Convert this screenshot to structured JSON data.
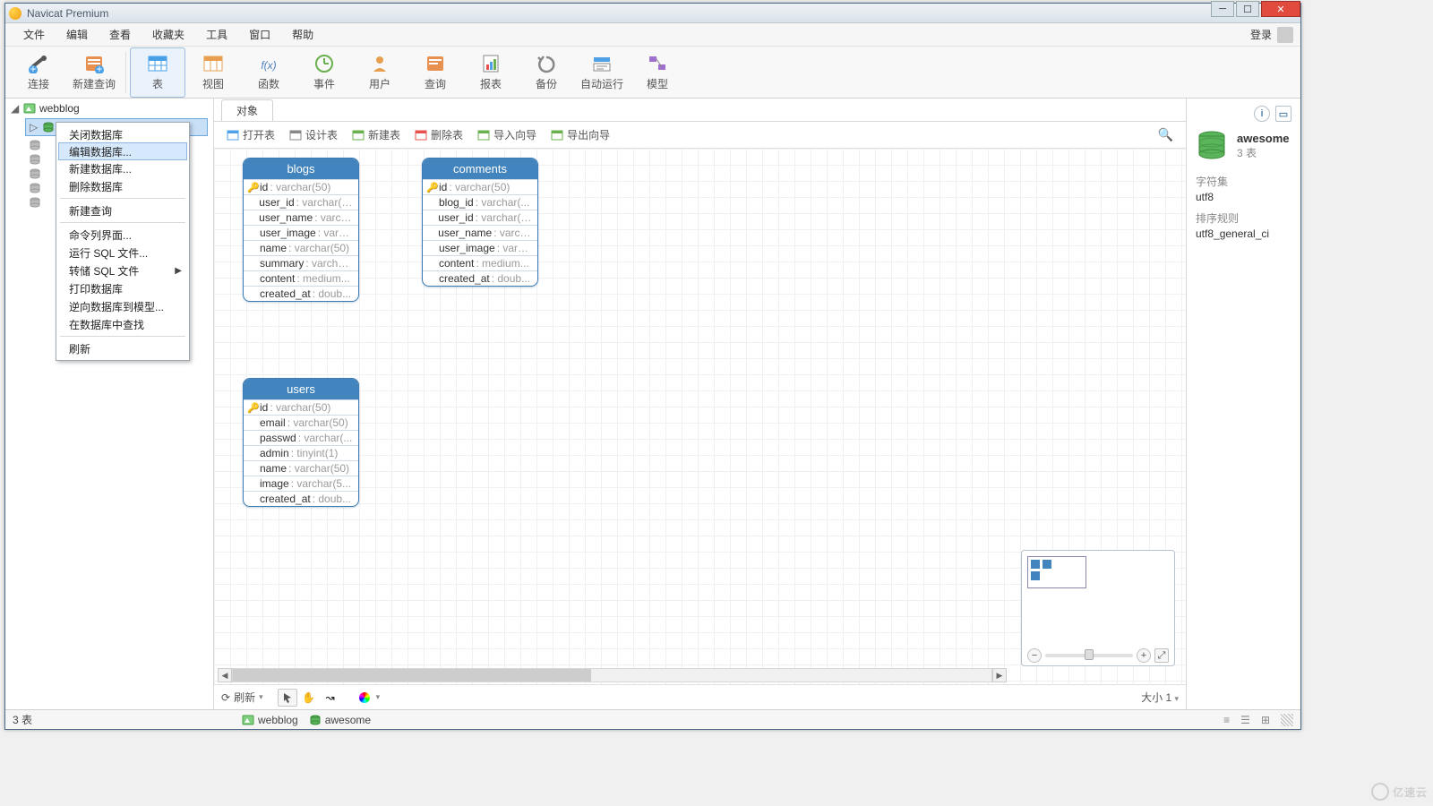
{
  "title": "Navicat Premium",
  "menubar": [
    "文件",
    "编辑",
    "查看",
    "收藏夹",
    "工具",
    "窗口",
    "帮助"
  ],
  "login": "登录",
  "toolbar": [
    {
      "icon": "conn",
      "label": "连接"
    },
    {
      "icon": "query",
      "label": "新建查询"
    },
    {
      "sep": true
    },
    {
      "icon": "table",
      "label": "表",
      "active": true
    },
    {
      "icon": "view",
      "label": "视图"
    },
    {
      "icon": "func",
      "label": "函数"
    },
    {
      "icon": "event",
      "label": "事件"
    },
    {
      "icon": "user",
      "label": "用户"
    },
    {
      "icon": "query2",
      "label": "查询"
    },
    {
      "icon": "report",
      "label": "报表"
    },
    {
      "icon": "backup",
      "label": "备份"
    },
    {
      "icon": "auto",
      "label": "自动运行"
    },
    {
      "icon": "model",
      "label": "模型"
    }
  ],
  "tree": {
    "root": "webblog"
  },
  "context_menu": [
    {
      "label": "关闭数据库"
    },
    {
      "label": "编辑数据库...",
      "hover": true
    },
    {
      "label": "新建数据库..."
    },
    {
      "label": "删除数据库"
    },
    {
      "sep": true
    },
    {
      "label": "新建查询"
    },
    {
      "sep": true
    },
    {
      "label": "命令列界面..."
    },
    {
      "label": "运行 SQL 文件..."
    },
    {
      "label": "转储 SQL 文件",
      "sub": true
    },
    {
      "label": "打印数据库"
    },
    {
      "label": "逆向数据库到模型..."
    },
    {
      "label": "在数据库中查找"
    },
    {
      "sep": true
    },
    {
      "label": "刷新"
    }
  ],
  "tab": "对象",
  "subtoolbar": [
    {
      "icon": "open",
      "label": "打开表"
    },
    {
      "icon": "design",
      "label": "设计表"
    },
    {
      "icon": "new",
      "label": "新建表",
      "green": true
    },
    {
      "icon": "del",
      "label": "删除表"
    },
    {
      "icon": "import",
      "label": "导入向导"
    },
    {
      "icon": "export",
      "label": "导出向导"
    }
  ],
  "entities": {
    "blogs": {
      "name": "blogs",
      "cols": [
        {
          "k": true,
          "n": "id",
          "t": ": varchar(50)"
        },
        {
          "n": "user_id",
          "t": ": varchar(5..."
        },
        {
          "n": "user_name",
          "t": ": varch..."
        },
        {
          "n": "user_image",
          "t": ": varc..."
        },
        {
          "n": "name",
          "t": ": varchar(50)"
        },
        {
          "n": "summary",
          "t": ": varcha..."
        },
        {
          "n": "content",
          "t": ": medium..."
        },
        {
          "n": "created_at",
          "t": ": doub..."
        }
      ]
    },
    "comments": {
      "name": "comments",
      "cols": [
        {
          "k": true,
          "n": "id",
          "t": ": varchar(50)"
        },
        {
          "n": "blog_id",
          "t": ": varchar(..."
        },
        {
          "n": "user_id",
          "t": ": varchar(5..."
        },
        {
          "n": "user_name",
          "t": ": varch..."
        },
        {
          "n": "user_image",
          "t": ": varc..."
        },
        {
          "n": "content",
          "t": ": medium..."
        },
        {
          "n": "created_at",
          "t": ": doub..."
        }
      ]
    },
    "users": {
      "name": "users",
      "cols": [
        {
          "k": true,
          "n": "id",
          "t": ": varchar(50)"
        },
        {
          "n": "email",
          "t": ": varchar(50)"
        },
        {
          "n": "passwd",
          "t": ": varchar(..."
        },
        {
          "n": "admin",
          "t": ": tinyint(1)"
        },
        {
          "n": "name",
          "t": ": varchar(50)"
        },
        {
          "n": "image",
          "t": ": varchar(5..."
        },
        {
          "n": "created_at",
          "t": ": doub..."
        }
      ]
    }
  },
  "canvas_status": {
    "refresh": "刷新",
    "size": "大小 1"
  },
  "rightpanel": {
    "db_name": "awesome",
    "db_sub": "3 表",
    "charset_label": "字符集",
    "charset_val": "utf8",
    "collation_label": "排序规则",
    "collation_val": "utf8_general_ci"
  },
  "statusbar": {
    "left": "3 表",
    "conn": "webblog",
    "db": "awesome"
  },
  "watermark": "亿速云"
}
